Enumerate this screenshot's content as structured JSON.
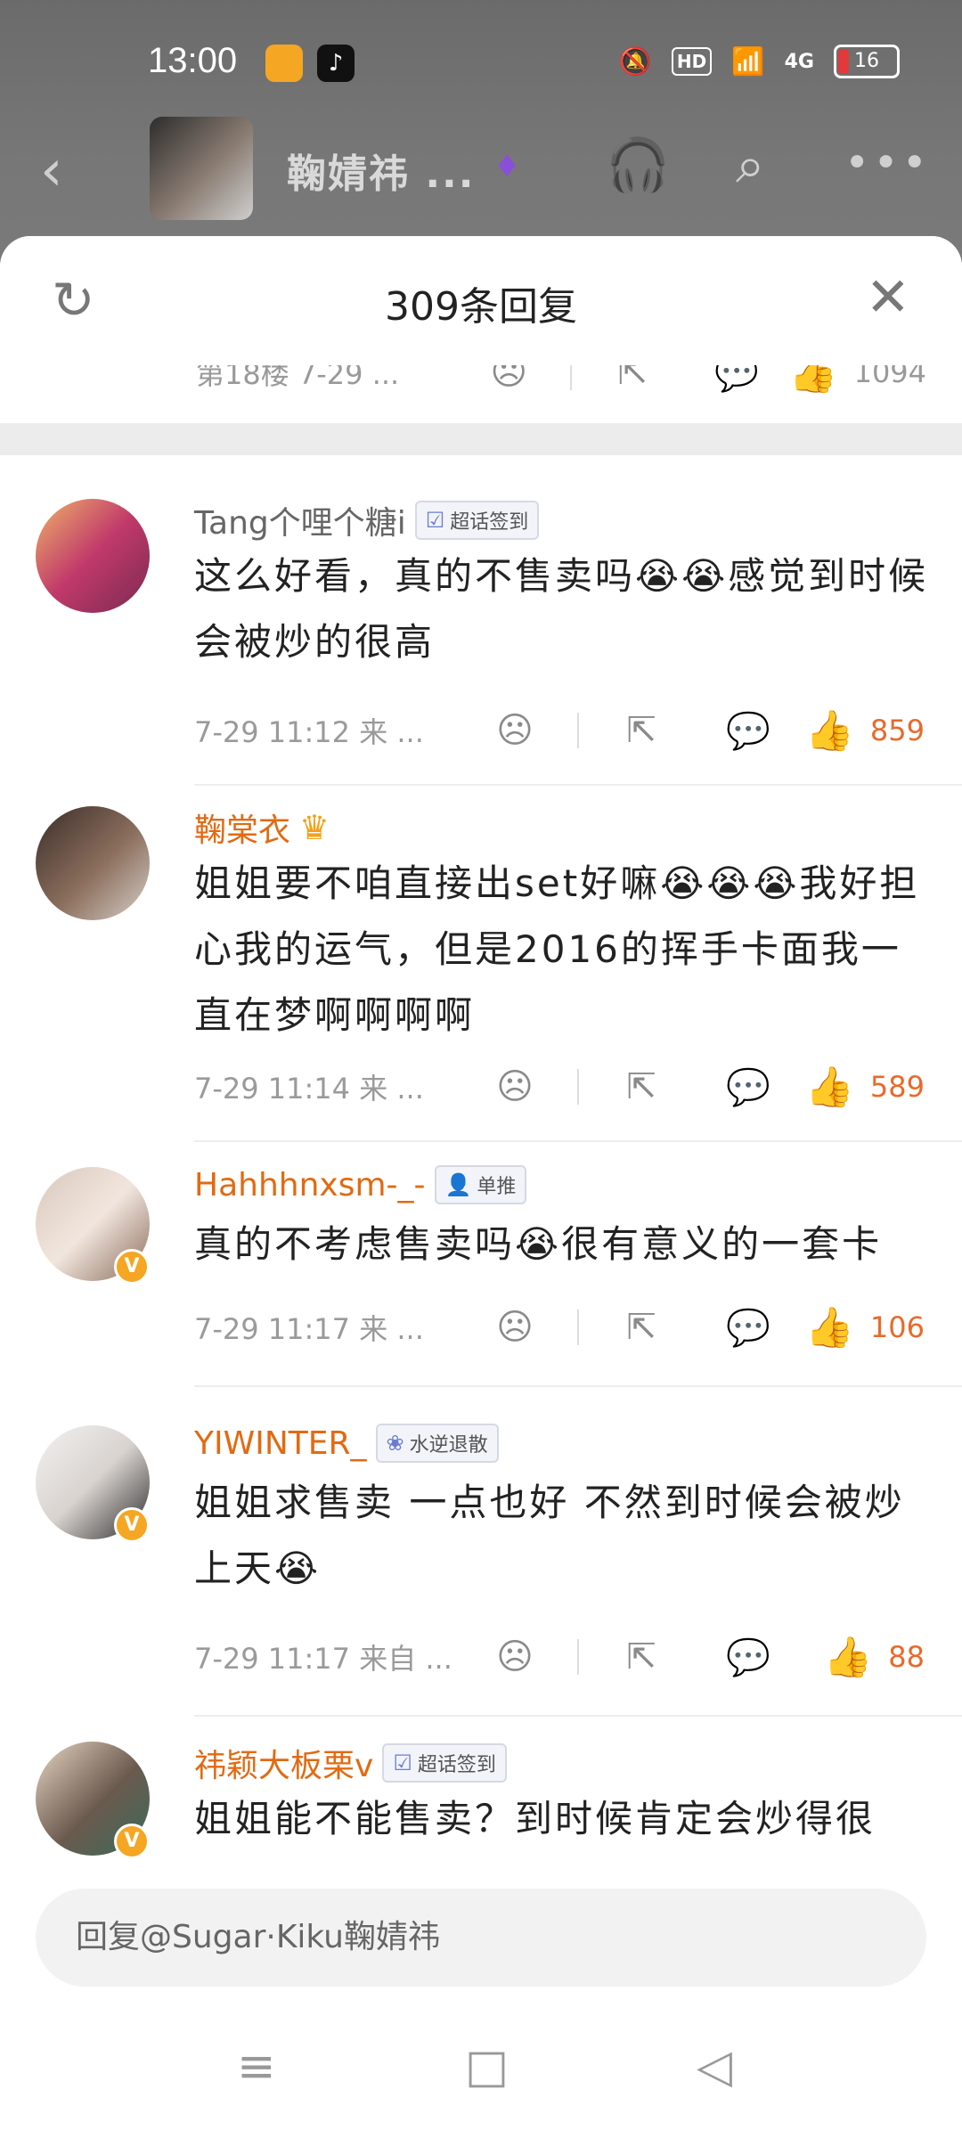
{
  "status_bar": {
    "time": "13:00",
    "hd": "HD",
    "network": "4G",
    "battery": "16"
  },
  "header": {
    "title": "鞠婧祎 ...",
    "listen_icon_label": "听"
  },
  "sheet": {
    "title": "309条回复",
    "prev_comment": {
      "meta": "第18楼  7-29 ...",
      "likes": "1094"
    }
  },
  "comments": [
    {
      "username": "Tang个哩个糖i",
      "tag": "超话签到",
      "text": "这么好看，真的不售卖吗😭😭感觉到时候会被炒的很高",
      "time": "7-29 11:12  来 ...",
      "likes": "859"
    },
    {
      "username": "鞠棠衣",
      "text": "姐姐要不咱直接出set好嘛😭😭😭我好担心我的运气，但是2016的挥手卡面我一直在梦啊啊啊啊",
      "time": "7-29 11:14  来 ...",
      "likes": "589"
    },
    {
      "username": "Hahhhnxsm-_-",
      "tag": "单推",
      "text": "真的不考虑售卖吗😭很有意义的一套卡",
      "time": "7-29 11:17  来 ...",
      "likes": "106"
    },
    {
      "username": "YIWINTER_",
      "tag": "水逆退散",
      "text": "姐姐求售卖 一点也好 不然到时候会被炒上天😭",
      "time": "7-29 11:17  来自 ...",
      "likes": "88"
    },
    {
      "username": "祎颖大板栗v",
      "tag": "超话签到",
      "text": "姐姐能不能售卖？到时候肯定会炒得很"
    }
  ],
  "reply_input": {
    "placeholder": "回复@Sugar·Kiku鞠婧祎"
  },
  "colors": {
    "accent_orange": "#e26a12",
    "like_orange": "#f07a2a"
  }
}
